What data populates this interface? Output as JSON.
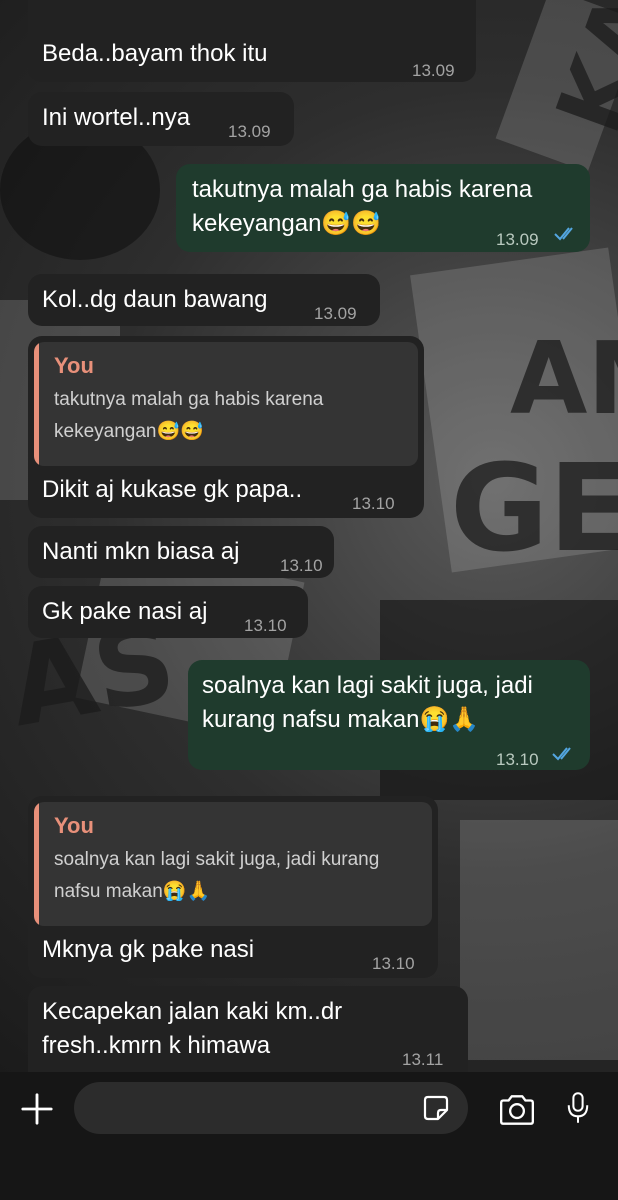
{
  "messages": [
    {
      "direction": "in",
      "text": "Beda..bayam thok itu",
      "time": "13.09"
    },
    {
      "direction": "in",
      "text": "Ini wortel..nya",
      "time": "13.09"
    },
    {
      "direction": "out",
      "lines": [
        "takutnya malah ga habis karena",
        "kekeyangan😅😅"
      ],
      "time": "13.09",
      "status": "read"
    },
    {
      "direction": "in",
      "text": "Kol..dg daun bawang",
      "time": "13.09"
    },
    {
      "direction": "in",
      "quote": {
        "author": "You",
        "lines": [
          "takutnya malah ga habis karena",
          "kekeyangan😅😅"
        ]
      },
      "text": "Dikit aj kukase gk papa..",
      "time": "13.10"
    },
    {
      "direction": "in",
      "text": "Nanti mkn biasa aj",
      "time": "13.10"
    },
    {
      "direction": "in",
      "text": "Gk pake nasi aj",
      "time": "13.10"
    },
    {
      "direction": "out",
      "lines": [
        "soalnya kan lagi sakit juga, jadi",
        "kurang nafsu makan😭🙏"
      ],
      "time": "13.10",
      "status": "read"
    },
    {
      "direction": "in",
      "quote": {
        "author": "You",
        "lines": [
          "soalnya kan lagi sakit juga, jadi kurang",
          "nafsu makan😭🙏"
        ]
      },
      "text": "Mknya gk pake nasi",
      "time": "13.10"
    },
    {
      "direction": "in",
      "lines": [
        "Kecapekan jalan kaki km..dr",
        "fresh..kmrn k himawa"
      ],
      "time": "13.11"
    }
  ],
  "composer": {
    "value": "",
    "icons": {
      "attach": "plus-icon",
      "sticker": "sticker-icon",
      "camera": "camera-icon",
      "voice": "microphone-icon"
    }
  },
  "colors": {
    "incoming": "#222222",
    "outgoing": "#1f3b2d",
    "quote_accent": "#e8907a",
    "read_ticks": "#53a6e0"
  }
}
